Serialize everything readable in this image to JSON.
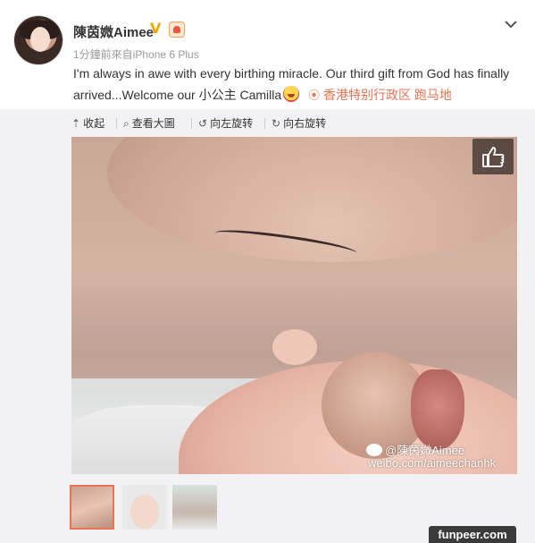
{
  "post": {
    "author_name": "陳茵媺Aimee",
    "verified_badge": "V",
    "meta": "1分鐘前來自iPhone 6 Plus",
    "text_part1": "I'm always in awe with every birthing miracle. Our third gift from God has finally arrived...Welcome our 小公主 Camilla",
    "location": "香港特别行政区 跑马地",
    "location_icon": "pin-icon",
    "accent_color": "#eb7350"
  },
  "toolbar": {
    "collapse_label": "收起",
    "view_large_label": "查看大圖",
    "rotate_left_label": "向左旋转",
    "rotate_right_label": "向右旋转"
  },
  "photo": {
    "watermark_name": "@陳茵媺Aimee",
    "watermark_url": "weibo.com/aimeechanhk"
  },
  "thumbnails": [
    "photo-1",
    "photo-2",
    "photo-3"
  ],
  "site_watermark": "funpeer.com"
}
